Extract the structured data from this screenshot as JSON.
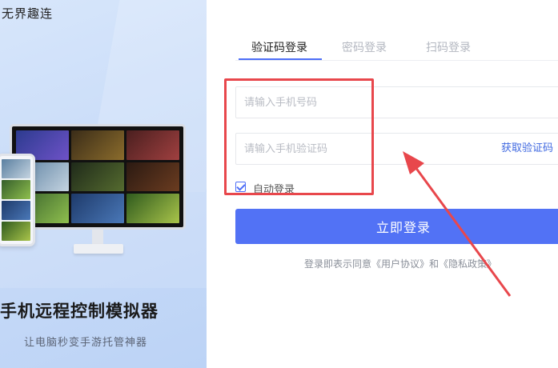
{
  "brand": "无界趣连",
  "left_panel": {
    "title": "手机远程控制模拟器",
    "subtitle": "让电脑秒变手游托管神器"
  },
  "tabs": [
    {
      "label": "验证码登录",
      "active": true
    },
    {
      "label": "密码登录",
      "active": false
    },
    {
      "label": "扫码登录",
      "active": false
    }
  ],
  "form": {
    "phone_placeholder": "请输入手机号码",
    "code_placeholder": "请输入手机验证码",
    "get_code_label": "获取验证码",
    "auto_login_label": "自动登录",
    "auto_login_checked": true,
    "login_button": "立即登录"
  },
  "agreement": {
    "prefix": "登录即表示同意",
    "user_agreement": "《用户协议》",
    "and": "和",
    "privacy_policy": "《隐私政策》"
  },
  "colors": {
    "accent": "#5272f5",
    "annotation": "#e8474c"
  }
}
